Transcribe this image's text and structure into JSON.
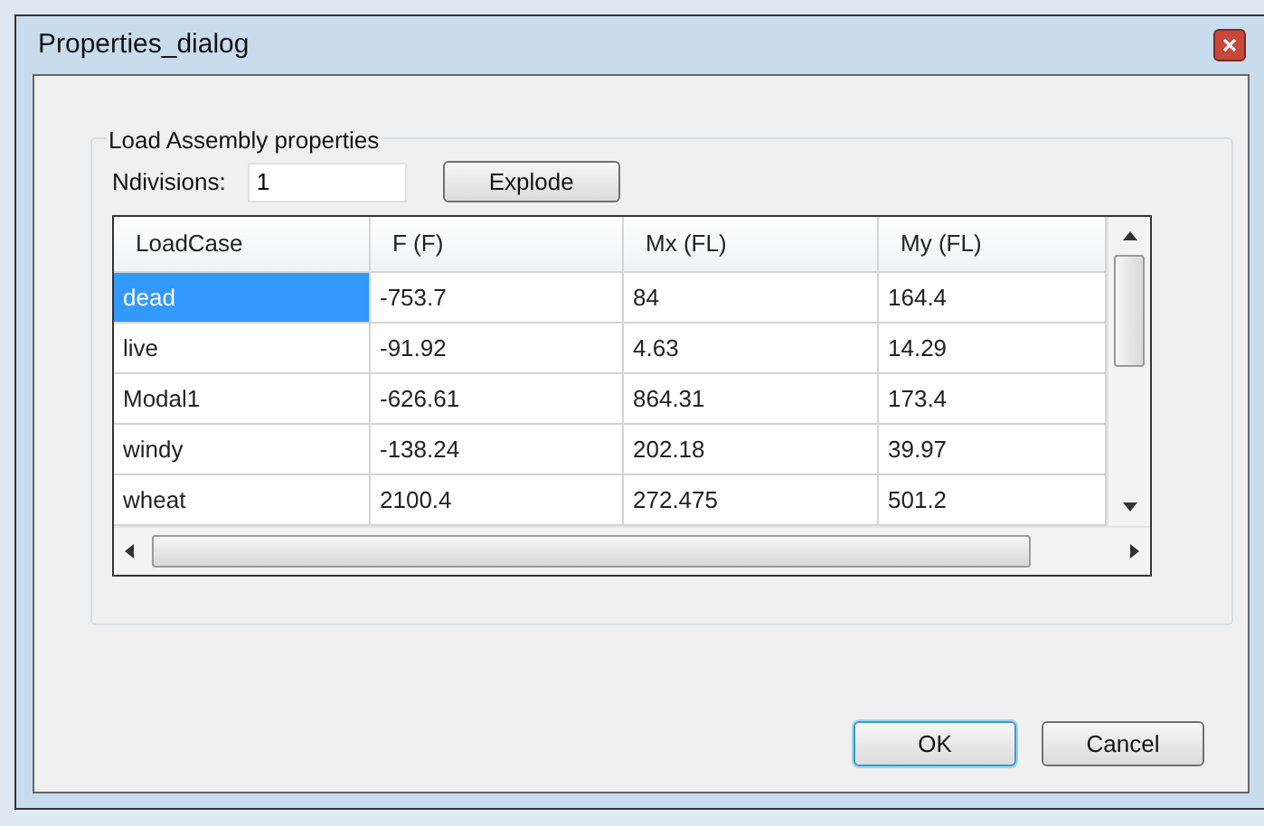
{
  "window": {
    "title": "Properties_dialog"
  },
  "group": {
    "title": "Load Assembly properties"
  },
  "ndivisions": {
    "label": "Ndivisions:",
    "value": "1"
  },
  "explode_button": "Explode",
  "table": {
    "columns": [
      "LoadCase",
      "F (F)",
      "Mx (FL)",
      "My (FL)"
    ],
    "rows": [
      {
        "cells": [
          "dead",
          "-753.7",
          "84",
          "164.4"
        ],
        "selected": true
      },
      {
        "cells": [
          "live",
          "-91.92",
          "4.63",
          "14.29"
        ],
        "selected": false
      },
      {
        "cells": [
          "Modal1",
          "-626.61",
          "864.31",
          "173.4"
        ],
        "selected": false
      },
      {
        "cells": [
          "windy",
          "-138.24",
          "202.18",
          "39.97"
        ],
        "selected": false
      },
      {
        "cells": [
          "wheat",
          "2100.4",
          "272.475",
          "501.2"
        ],
        "selected": false
      }
    ]
  },
  "buttons": [
    {
      "label": "OK",
      "default": true
    },
    {
      "label": "Cancel",
      "default": false
    }
  ]
}
